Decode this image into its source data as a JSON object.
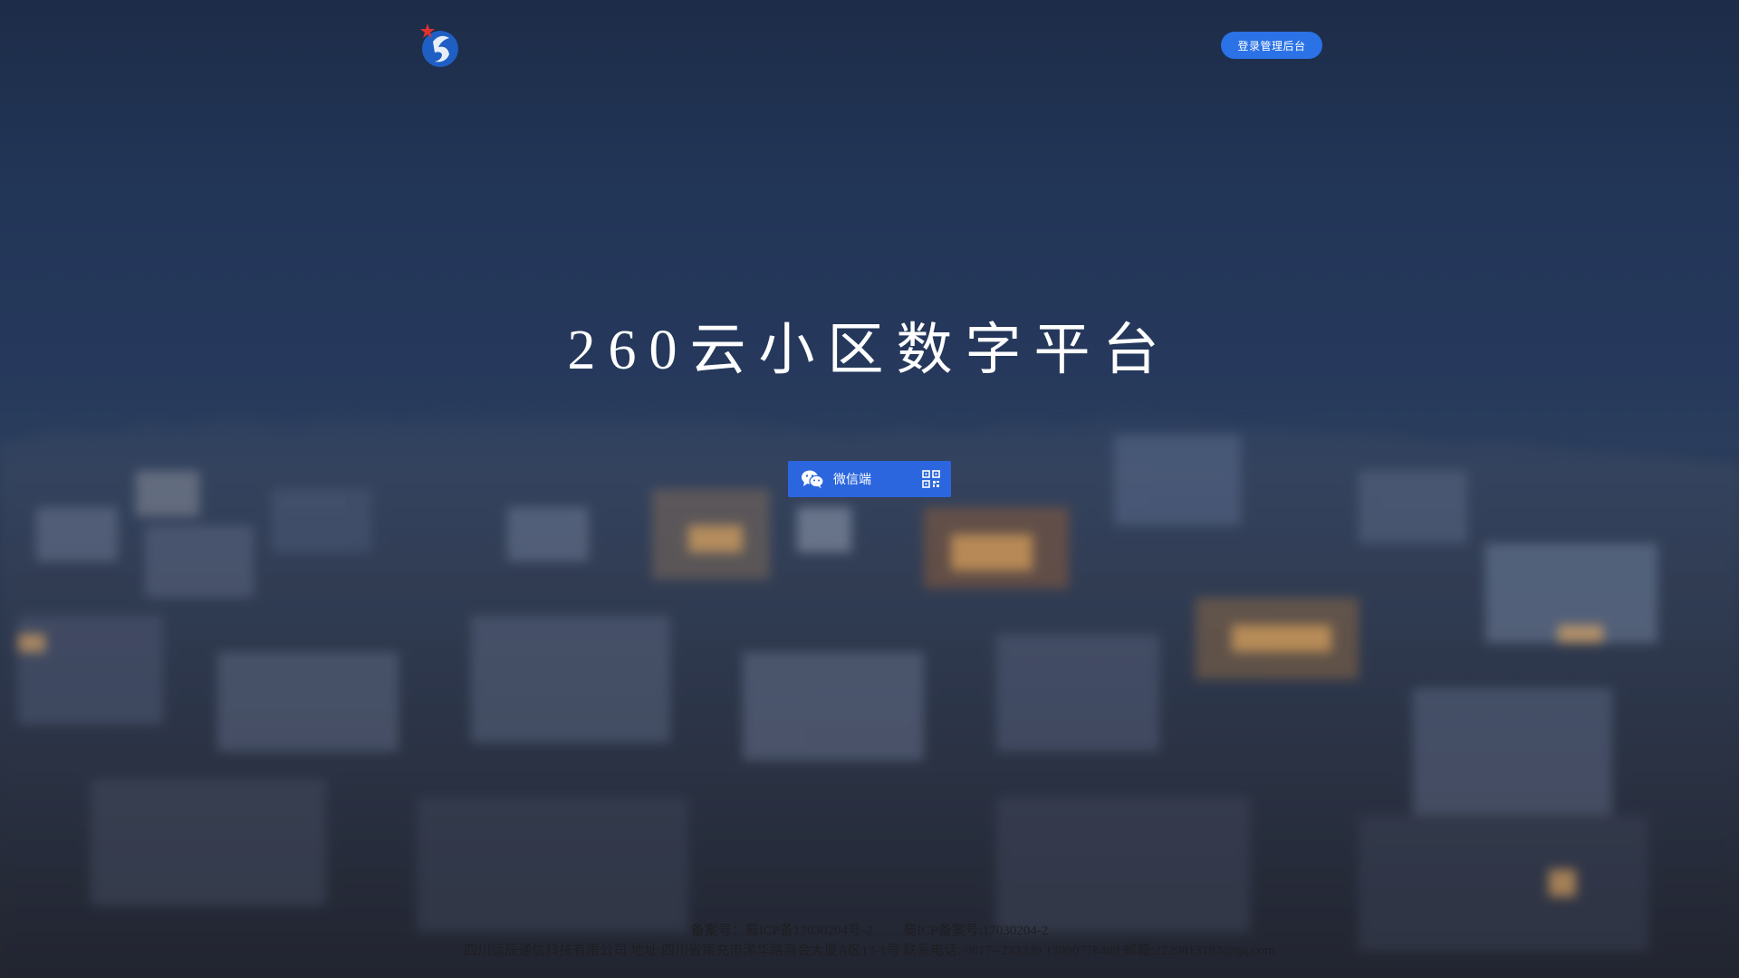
{
  "header": {
    "login_label": "登录管理后台"
  },
  "hero": {
    "title": "260云小区数字平台"
  },
  "wechat": {
    "label": "微信端"
  },
  "footer": {
    "record_a": "备案号：蜀ICP备17030204号-2",
    "record_b": "蜀ICP备案号:17030204-2",
    "company_line": "四川远辰通信科技有限公司 地址:四川省南充市潆华路商会大厦A区13-1号 联系电话: 0817--233339 13990778489 邮箱:2229813193@qq.com"
  },
  "colors": {
    "accent": "#2a72e6",
    "wechat_button": "#2b66de",
    "sky_top": "#1d2c48",
    "title_text": "#ffffff"
  },
  "icons": {
    "logo": "company-logo-icon",
    "wechat": "wechat-icon",
    "qr": "qr-code-icon"
  }
}
